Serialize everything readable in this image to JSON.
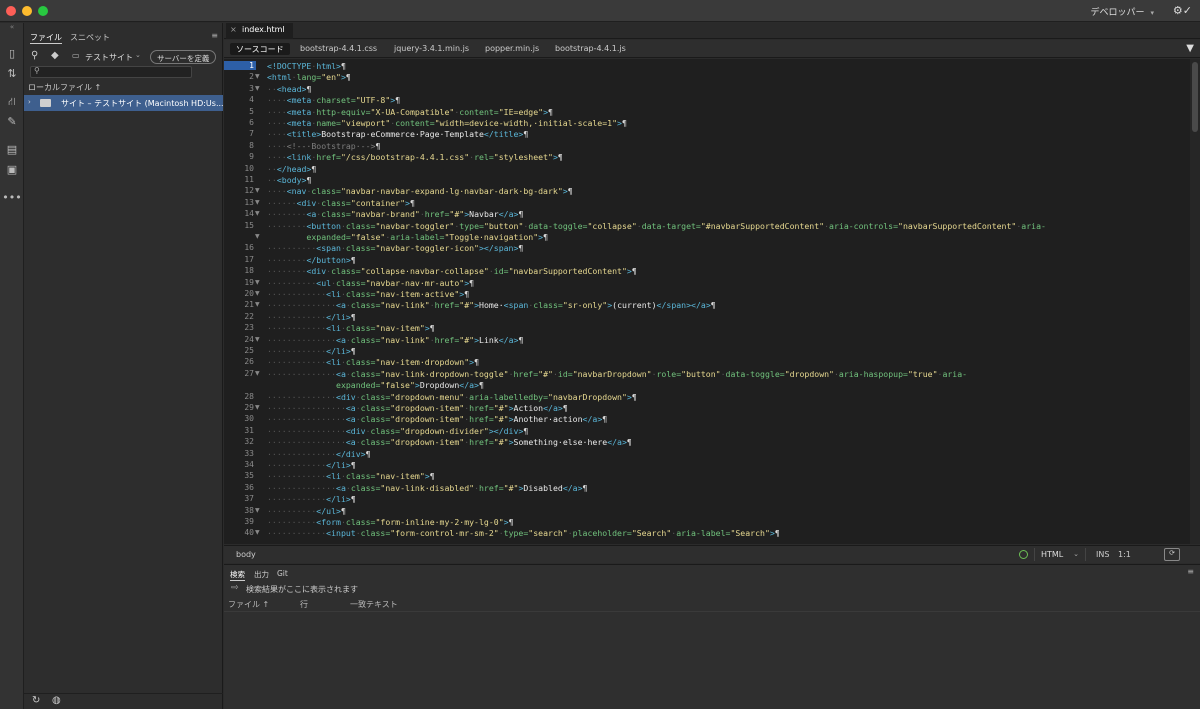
{
  "workspace": {
    "label": "デベロッパー",
    "caret": "▾",
    "settings_icon": "⚙✓"
  },
  "files_panel": {
    "tabs": [
      "ファイル",
      "スニペット"
    ],
    "site_select": "テストサイト",
    "define_server_button": "サーバーを定義",
    "local_files_header": "ローカルファイル ↑",
    "site_item": "サイト – テストサイト (Macintosh HD:Us..."
  },
  "document": {
    "tab_label": "index.html",
    "close_glyph": "×"
  },
  "related_files": [
    "ソースコード",
    "bootstrap-4.4.1.css",
    "jquery-3.4.1.min.js",
    "popper.min.js",
    "bootstrap-4.4.1.js"
  ],
  "code": {
    "current_line": 1,
    "line_numbers": [
      "1",
      "2",
      "3",
      "4",
      "5",
      "6",
      "7",
      "8",
      "9",
      "10",
      "11",
      "12",
      "13",
      "14",
      "15",
      "",
      "16",
      "17",
      "18",
      "19",
      "20",
      "21",
      "22",
      "23",
      "24",
      "25",
      "26",
      "27",
      "",
      "28",
      "29",
      "30",
      "31",
      "32",
      "33",
      "34",
      "35",
      "36",
      "37",
      "38",
      "39",
      "40"
    ],
    "fold_rows": [
      1,
      2,
      11,
      12,
      13,
      15,
      19,
      20,
      21,
      24,
      27,
      30,
      39,
      41
    ]
  },
  "status_bar": {
    "tag": "body",
    "language": "HTML",
    "mode": "INS",
    "position": "1:1"
  },
  "output_panel": {
    "tabs": [
      "検索",
      "出力",
      "Git"
    ],
    "message": "検索結果がここに表示されます",
    "columns": [
      "ファイル ↑",
      "行",
      "一致テキスト"
    ]
  }
}
